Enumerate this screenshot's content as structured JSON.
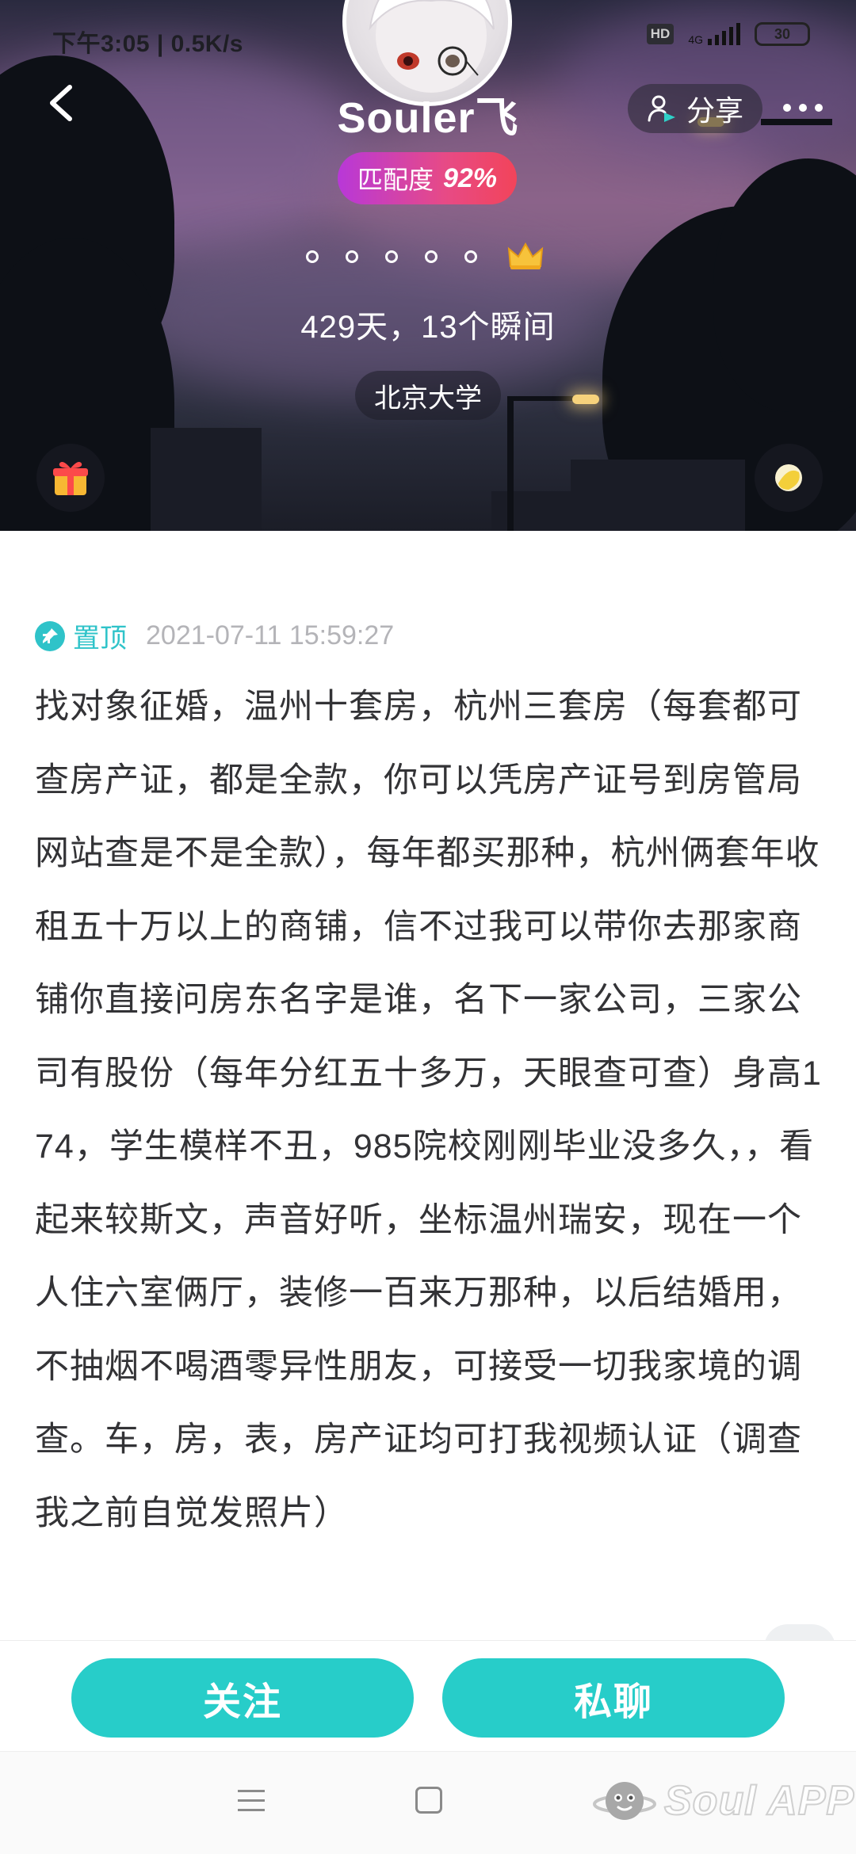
{
  "status_bar": {
    "time_speed": "下午3:05 | 0.5K/s",
    "hd": "HD",
    "network": "4G",
    "battery": "30"
  },
  "profile": {
    "username": "Souler飞",
    "share_label": "分享",
    "match_label": "匹配度",
    "match_percent": "92%",
    "level_dot_count": 5,
    "days_text": "429天，13个瞬间",
    "school": "北京大学"
  },
  "post": {
    "pin_label": "置顶",
    "timestamp": "2021-07-11 15:59:27",
    "content": "找对象征婚，温州十套房，杭州三套房（每套都可查房产证，都是全款，你可以凭房产证号到房管局网站查是不是全款），每年都买那种，杭州俩套年收租五十万以上的商铺，信不过我可以带你去那家商铺你直接问房东名字是谁，名下一家公司，三家公司有股份（每年分红五十多万，天眼查可查）身高174，学生模样不丑，985院校刚刚毕业没多久，，看起来较斯文，声音好听，坐标温州瑞安，现在一个人住六室俩厅，装修一百来万那种，以后结婚用，不抽烟不喝酒零异性朋友，可接受一切我家境的调查。车，房，表，房产证均可打我视频认证（调查我之前自觉发照片）"
  },
  "actions": {
    "follow_label": "关注",
    "chat_label": "私聊"
  },
  "watermark": {
    "text": "Soul APP"
  },
  "colors": {
    "accent_teal": "#27cdc9",
    "pin_teal": "#2fc3c9",
    "match_gradient_start": "#b838d8",
    "match_gradient_end": "#f2445a",
    "body_text": "#333336",
    "timestamp_gray": "#b4b4b8"
  },
  "icons": {
    "back": "chevron-left-icon",
    "share": "person-share-icon",
    "more": "more-dots-icon",
    "crown": "crown-icon",
    "gift": "gift-icon",
    "planet": "planet-icon",
    "pin": "pin-icon",
    "menu": "menu-icon",
    "home": "home-square-icon"
  }
}
